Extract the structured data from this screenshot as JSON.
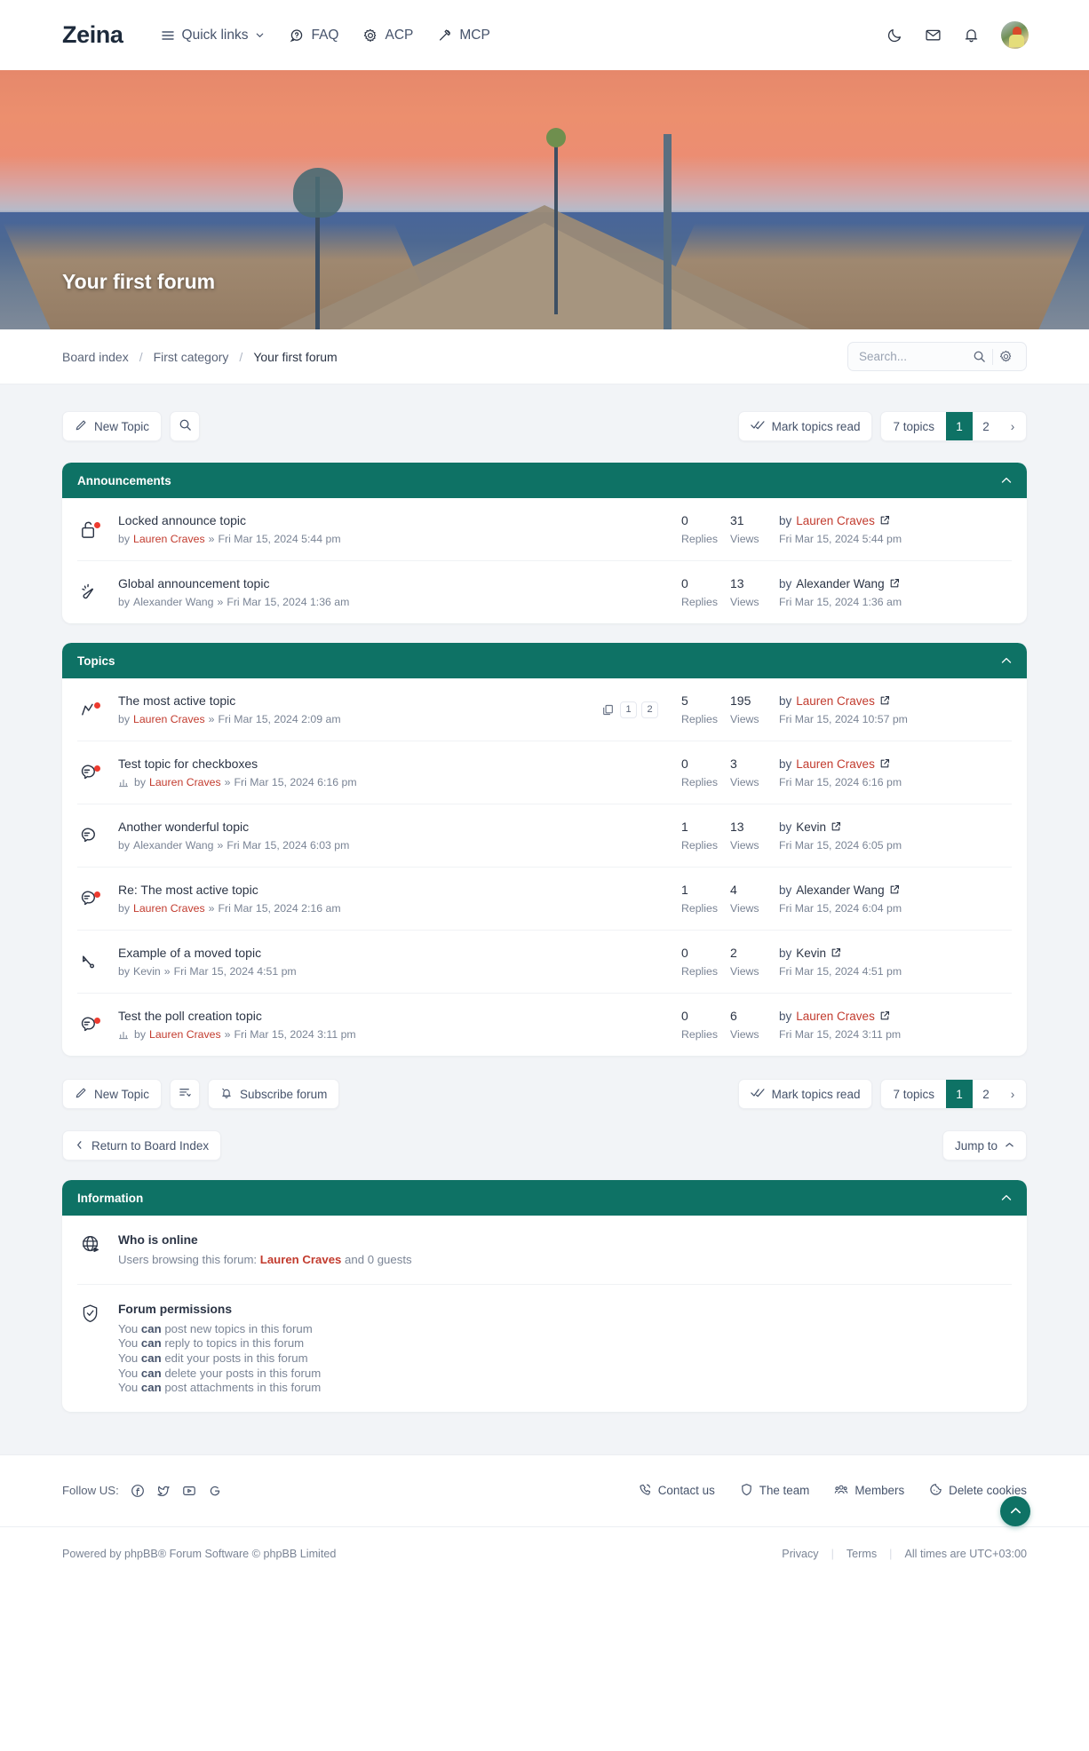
{
  "nav": {
    "brand": "Zeina",
    "items": [
      {
        "label": "Quick links",
        "icon": "hamburger-icon",
        "caret": true
      },
      {
        "label": "FAQ",
        "icon": "question-bubble-icon"
      },
      {
        "label": "ACP",
        "icon": "gear-icon"
      },
      {
        "label": "MCP",
        "icon": "gavel-icon"
      }
    ],
    "right_icons": [
      "moon-icon",
      "envelope-icon",
      "bell-icon",
      "avatar"
    ]
  },
  "hero": {
    "title": "Your first forum"
  },
  "breadcrumb": {
    "items": [
      "Board index",
      "First category",
      "Your first forum"
    ],
    "separator": "/"
  },
  "search": {
    "placeholder": "Search...",
    "value": ""
  },
  "toolbar": {
    "new_topic": "New Topic",
    "search_icon_label": "search-icon",
    "mark_read": "Mark topics read",
    "topic_count": "7 topics",
    "pages": [
      "1",
      "2"
    ],
    "active_page": "1",
    "next_arrow": "›"
  },
  "toolbar_bottom": {
    "new_topic": "New Topic",
    "display_options_icon": "sort-icon",
    "subscribe": "Subscribe forum",
    "mark_read": "Mark topics read",
    "topic_count": "7 topics",
    "pages": [
      "1",
      "2"
    ],
    "active_page": "1",
    "next_arrow": "›"
  },
  "jumprow": {
    "return_label": "Return to Board Index",
    "jump_label": "Jump to"
  },
  "announcements": {
    "title": "Announcements",
    "rows": [
      {
        "icon": "locked-topic-icon",
        "unread": true,
        "title": "Locked announce topic",
        "by": "by",
        "author": "Lauren Craves",
        "author_hot": true,
        "sep": "»",
        "date": "Fri Mar 15, 2024 5:44 pm",
        "replies": "0",
        "replies_label": "Replies",
        "views": "31",
        "views_label": "Views",
        "last_by": "by",
        "last_author": "Lauren Craves",
        "last_author_hot": true,
        "last_date": "Fri Mar 15, 2024 5:44 pm"
      },
      {
        "icon": "megaphone-icon",
        "unread": false,
        "title": "Global announcement topic",
        "by": "by",
        "author": "Alexander Wang",
        "author_hot": false,
        "sep": "»",
        "date": "Fri Mar 15, 2024 1:36 am",
        "replies": "0",
        "replies_label": "Replies",
        "views": "13",
        "views_label": "Views",
        "last_by": "by",
        "last_author": "Alexander Wang",
        "last_author_hot": false,
        "last_date": "Fri Mar 15, 2024 1:36 am"
      }
    ]
  },
  "topics": {
    "title": "Topics",
    "rows": [
      {
        "icon": "hot-topic-icon",
        "unread": true,
        "title": "The most active topic",
        "by": "by",
        "author": "Lauren Craves",
        "author_hot": true,
        "sep": "»",
        "date": "Fri Mar 15, 2024 2:09 am",
        "poll": false,
        "minipages": [
          "1",
          "2"
        ],
        "replies": "5",
        "replies_label": "Replies",
        "views": "195",
        "views_label": "Views",
        "last_by": "by",
        "last_author": "Lauren Craves",
        "last_author_hot": true,
        "last_date": "Fri Mar 15, 2024 10:57 pm"
      },
      {
        "icon": "topic-bubble-icon",
        "unread": true,
        "title": "Test topic for checkboxes",
        "by": "by",
        "author": "Lauren Craves",
        "author_hot": true,
        "sep": "»",
        "date": "Fri Mar 15, 2024 6:16 pm",
        "poll": true,
        "minipages": [],
        "replies": "0",
        "replies_label": "Replies",
        "views": "3",
        "views_label": "Views",
        "last_by": "by",
        "last_author": "Lauren Craves",
        "last_author_hot": true,
        "last_date": "Fri Mar 15, 2024 6:16 pm"
      },
      {
        "icon": "topic-bubble-icon",
        "unread": false,
        "title": "Another wonderful topic",
        "by": "by",
        "author": "Alexander Wang",
        "author_hot": false,
        "sep": "»",
        "date": "Fri Mar 15, 2024 6:03 pm",
        "poll": false,
        "minipages": [],
        "replies": "1",
        "replies_label": "Replies",
        "views": "13",
        "views_label": "Views",
        "last_by": "by",
        "last_author": "Kevin",
        "last_author_hot": false,
        "last_date": "Fri Mar 15, 2024 6:05 pm"
      },
      {
        "icon": "topic-bubble-icon",
        "unread": true,
        "title": "Re: The most active topic",
        "by": "by",
        "author": "Lauren Craves",
        "author_hot": true,
        "sep": "»",
        "date": "Fri Mar 15, 2024 2:16 am",
        "poll": false,
        "minipages": [],
        "replies": "1",
        "replies_label": "Replies",
        "views": "4",
        "views_label": "Views",
        "last_by": "by",
        "last_author": "Alexander Wang",
        "last_author_hot": false,
        "last_date": "Fri Mar 15, 2024 6:04 pm"
      },
      {
        "icon": "moved-topic-icon",
        "unread": false,
        "title": "Example of a moved topic",
        "by": "by",
        "author": "Kevin",
        "author_hot": false,
        "sep": "»",
        "date": "Fri Mar 15, 2024 4:51 pm",
        "poll": false,
        "minipages": [],
        "replies": "0",
        "replies_label": "Replies",
        "views": "2",
        "views_label": "Views",
        "last_by": "by",
        "last_author": "Kevin",
        "last_author_hot": false,
        "last_date": "Fri Mar 15, 2024 4:51 pm"
      },
      {
        "icon": "topic-bubble-icon",
        "unread": true,
        "title": "Test the poll creation topic",
        "by": "by",
        "author": "Lauren Craves",
        "author_hot": true,
        "sep": "»",
        "date": "Fri Mar 15, 2024 3:11 pm",
        "poll": true,
        "minipages": [],
        "replies": "0",
        "replies_label": "Replies",
        "views": "6",
        "views_label": "Views",
        "last_by": "by",
        "last_author": "Lauren Craves",
        "last_author_hot": true,
        "last_date": "Fri Mar 15, 2024 3:11 pm"
      }
    ]
  },
  "information": {
    "title": "Information",
    "who_online": {
      "icon": "globe-icon",
      "heading": "Who is online",
      "prefix": "Users browsing this forum: ",
      "user": "Lauren Craves",
      "suffix": " and 0 guests"
    },
    "permissions": {
      "icon": "shield-check-icon",
      "heading": "Forum permissions",
      "lines": [
        {
          "pre": "You ",
          "can": "can",
          "post": " post new topics in this forum"
        },
        {
          "pre": "You ",
          "can": "can",
          "post": " reply to topics in this forum"
        },
        {
          "pre": "You ",
          "can": "can",
          "post": " edit your posts in this forum"
        },
        {
          "pre": "You ",
          "can": "can",
          "post": " delete your posts in this forum"
        },
        {
          "pre": "You ",
          "can": "can",
          "post": " post attachments in this forum"
        }
      ]
    }
  },
  "footer": {
    "follow_label": "Follow US:",
    "social": [
      "facebook-icon",
      "twitter-icon",
      "youtube-icon",
      "google-icon"
    ],
    "links": [
      {
        "label": "Contact us",
        "icon": "phone-icon"
      },
      {
        "label": "The team",
        "icon": "shield-icon"
      },
      {
        "label": "Members",
        "icon": "people-icon"
      },
      {
        "label": "Delete cookies",
        "icon": "cookie-icon"
      }
    ],
    "copyright": "Powered by phpBB® Forum Software © phpBB Limited",
    "privacy": "Privacy",
    "terms": "Terms",
    "timezone": "All times are UTC+03:00"
  },
  "colors": {
    "accent": "#0e7265",
    "hot_link": "#c23b2e",
    "text": "#2b3445",
    "muted": "#7a8495",
    "page_bg": "#f2f4f7"
  }
}
